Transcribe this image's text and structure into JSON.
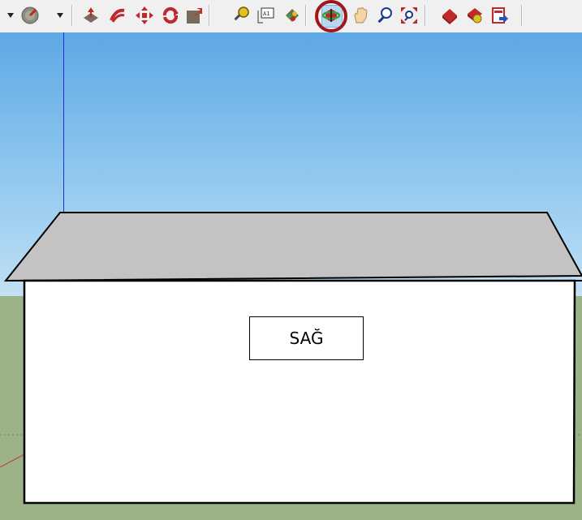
{
  "toolbar": {
    "tools": [
      {
        "name": "select-dropdown-arrow"
      },
      {
        "name": "eraser-icon"
      },
      {
        "name": "dropdown-arrow"
      },
      {
        "name": "push-pull-icon"
      },
      {
        "name": "follow-me-icon"
      },
      {
        "name": "move-icon"
      },
      {
        "name": "rotate-icon"
      },
      {
        "name": "scale-icon"
      },
      {
        "name": "tape-measure-icon"
      },
      {
        "name": "text-tool-icon"
      },
      {
        "name": "paint-bucket-icon"
      },
      {
        "name": "orbit-icon",
        "active": true
      },
      {
        "name": "pan-icon"
      },
      {
        "name": "zoom-icon"
      },
      {
        "name": "zoom-extents-icon"
      },
      {
        "name": "warehouse-icon"
      },
      {
        "name": "extension-warehouse-icon"
      },
      {
        "name": "share-model-icon"
      }
    ],
    "text_tool_glyph": "A1",
    "highlight_color": "#a0141a"
  },
  "viewport": {
    "wall_label": "SAĞ",
    "sky_top_color": "#5ea8e6",
    "ground_color": "#9bb386",
    "roof_color": "#c3c3c3"
  }
}
